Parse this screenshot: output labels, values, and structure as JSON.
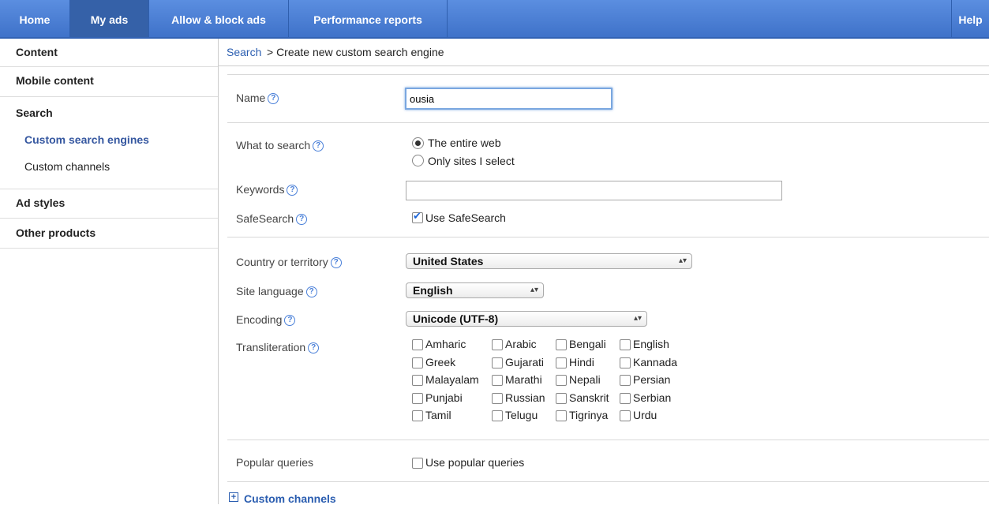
{
  "nav": {
    "tabs": [
      "Home",
      "My ads",
      "Allow & block ads",
      "Performance reports"
    ],
    "active": "My ads",
    "help": "Help"
  },
  "sidebar": {
    "content": "Content",
    "mobile": "Mobile content",
    "search": "Search",
    "cse": "Custom search engines",
    "channels": "Custom channels",
    "adstyles": "Ad styles",
    "other": "Other products"
  },
  "breadcrumb": {
    "link": "Search",
    "rest": "> Create new custom search engine"
  },
  "form": {
    "name_label": "Name",
    "name_value": "ousia",
    "what_label": "What to search",
    "what_options": [
      "The entire web",
      "Only sites I select"
    ],
    "what_selected": "The entire web",
    "keywords_label": "Keywords",
    "keywords_value": "",
    "safesearch_label": "SafeSearch",
    "safesearch_option": "Use SafeSearch",
    "safesearch_checked": true,
    "country_label": "Country or territory",
    "country_value": "United States",
    "language_label": "Site language",
    "language_value": "English",
    "encoding_label": "Encoding",
    "encoding_value": "Unicode (UTF-8)",
    "translit_label": "Transliteration",
    "translit_options": [
      "Amharic",
      "Arabic",
      "Bengali",
      "English",
      "Greek",
      "Gujarati",
      "Hindi",
      "Kannada",
      "Malayalam",
      "Marathi",
      "Nepali",
      "Persian",
      "Punjabi",
      "Russian",
      "Sanskrit",
      "Serbian",
      "Tamil",
      "Telugu",
      "Tigrinya",
      "Urdu"
    ],
    "popular_label": "Popular queries",
    "popular_option": "Use popular queries",
    "popular_checked": false
  },
  "custom_channels": "Custom channels",
  "icons": {
    "help": "help-icon",
    "expand": "plus-icon"
  },
  "colors": {
    "nav_blue": "#4a7fd6",
    "link_blue": "#2a5db0"
  }
}
